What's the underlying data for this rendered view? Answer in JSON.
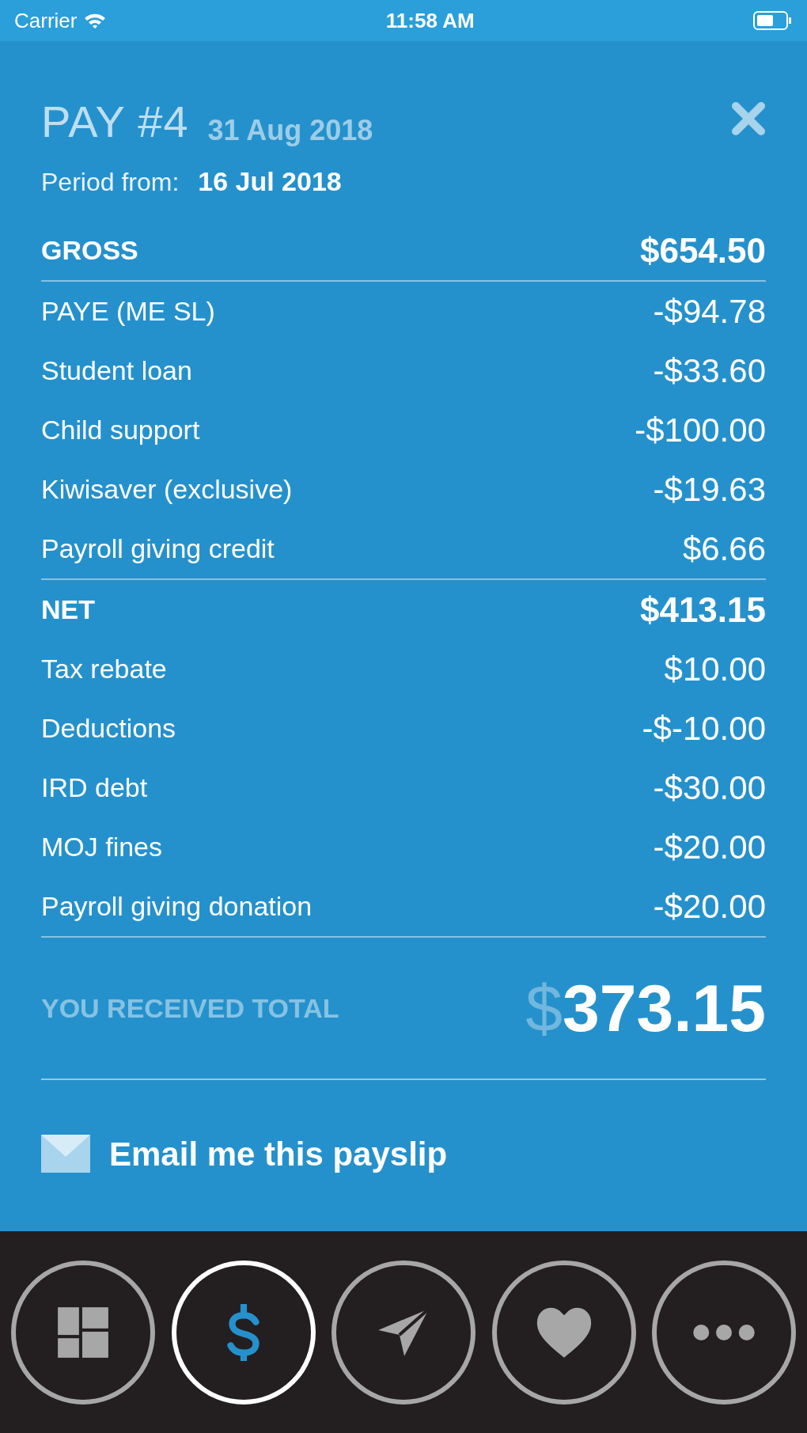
{
  "status_bar": {
    "carrier": "Carrier",
    "time": "11:58 AM"
  },
  "header": {
    "title": "PAY #4",
    "date": "31 Aug 2018",
    "period_label": "Period from:",
    "period_value": "16 Jul 2018"
  },
  "groups": [
    {
      "rows": [
        {
          "kind": "header",
          "label": "GROSS",
          "value": "$654.50"
        }
      ]
    },
    {
      "rows": [
        {
          "kind": "item",
          "label": "PAYE (ME SL)",
          "value": "-$94.78"
        },
        {
          "kind": "item",
          "label": "Student loan",
          "value": "-$33.60"
        },
        {
          "kind": "item",
          "label": "Child support",
          "value": "-$100.00"
        },
        {
          "kind": "item",
          "label": "Kiwisaver (exclusive)",
          "value": "-$19.63"
        },
        {
          "kind": "item",
          "label": "Payroll giving credit",
          "value": "$6.66"
        }
      ]
    },
    {
      "rows": [
        {
          "kind": "header",
          "label": "NET",
          "value": "$413.15"
        },
        {
          "kind": "item",
          "label": "Tax rebate",
          "value": "$10.00"
        },
        {
          "kind": "item",
          "label": "Deductions",
          "value": "-$-10.00"
        },
        {
          "kind": "item",
          "label": "IRD debt",
          "value": "-$30.00"
        },
        {
          "kind": "item",
          "label": "MOJ fines",
          "value": "-$20.00"
        },
        {
          "kind": "item",
          "label": "Payroll giving donation",
          "value": "-$20.00"
        }
      ]
    }
  ],
  "total": {
    "label": "YOU RECEIVED TOTAL",
    "currency": "$",
    "amount": "373.15"
  },
  "email": {
    "label": "Email me this payslip"
  },
  "tabs": [
    {
      "kind": "dashboard",
      "selected": false
    },
    {
      "kind": "dollar",
      "selected": true
    },
    {
      "kind": "send",
      "selected": false
    },
    {
      "kind": "heart",
      "selected": false
    },
    {
      "kind": "more",
      "selected": false
    }
  ]
}
